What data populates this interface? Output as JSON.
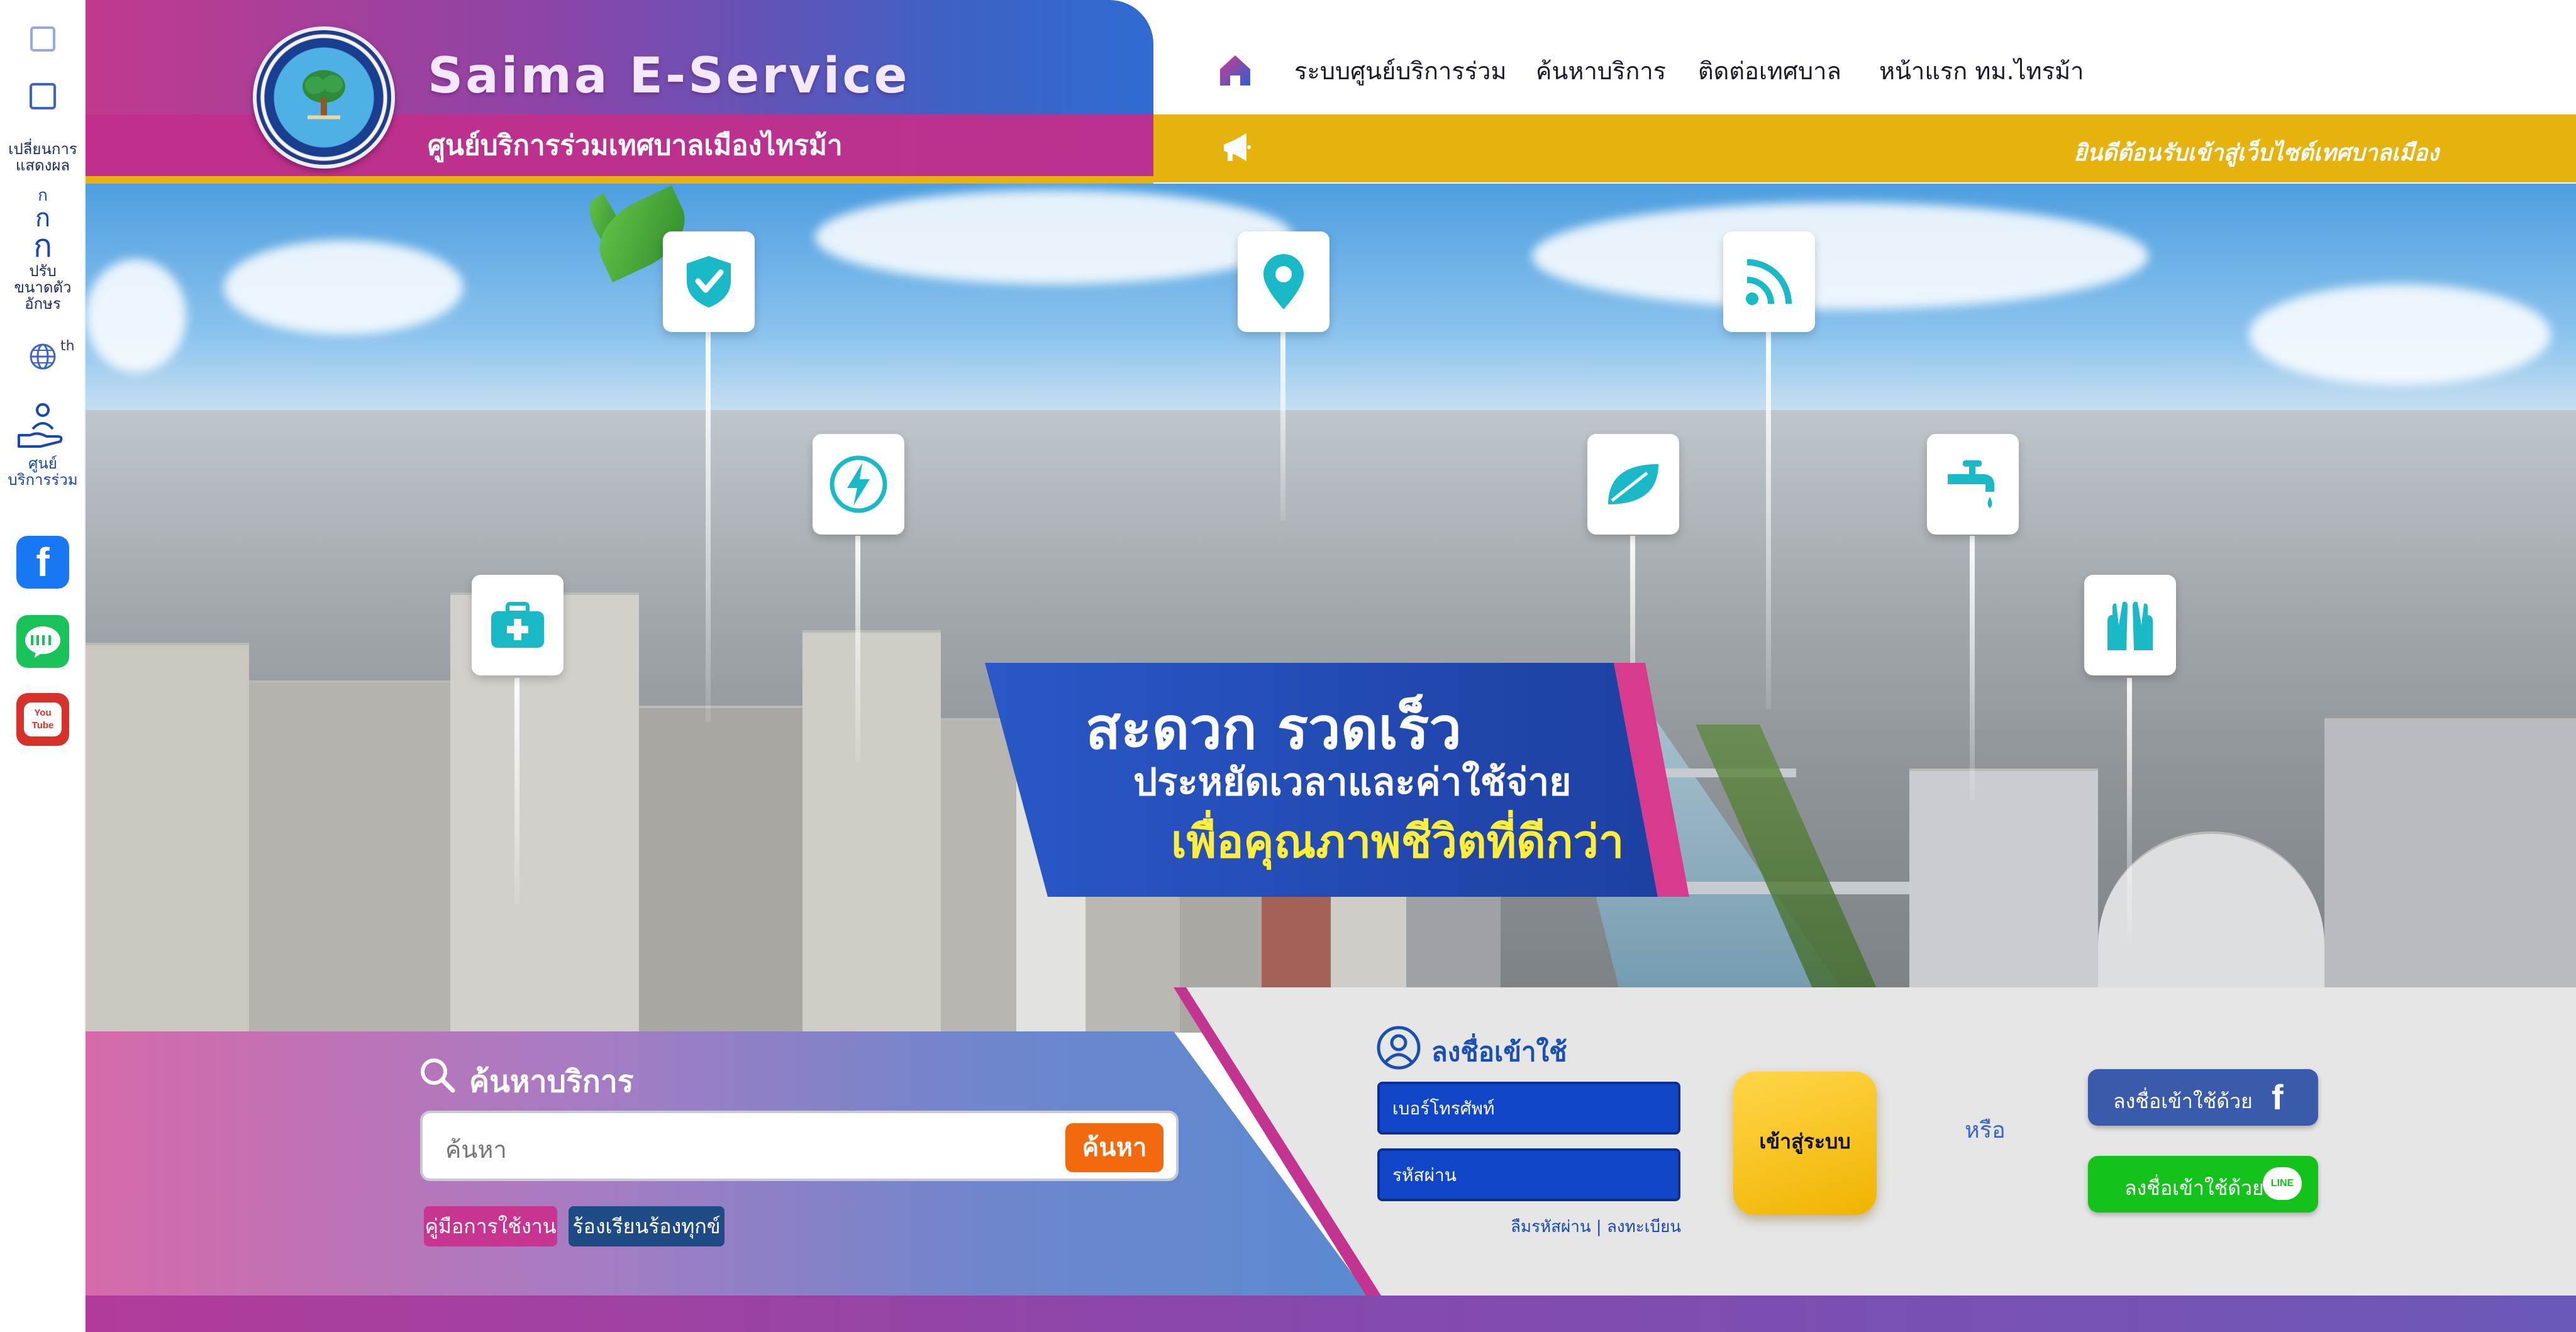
{
  "rail": {
    "display_switch_label_1": "เปลี่ยนการ",
    "display_switch_label_2": "แสดงผล",
    "font_small": "ก",
    "font_medium": "ก",
    "font_large": "ก",
    "font_label_1": "ปรับ",
    "font_label_2": "ขนาดตัว",
    "font_label_3": "อักษร",
    "language_code": "th",
    "service_center_label_1": "ศูนย์",
    "service_center_label_2": "บริการร่วม",
    "icons": [
      "grid-icon",
      "grid-icon",
      "globe-icon",
      "hand-service-icon",
      "facebook-icon",
      "line-icon",
      "youtube-icon"
    ],
    "youtube_label_1": "You",
    "youtube_label_2": "Tube"
  },
  "header": {
    "brand_title": "Saima E-Service",
    "brand_subtitle": "ศูนย์บริการร่วมเทศบาลเมืองไทรม้า",
    "nav": [
      "ระบบศูนย์บริการร่วม",
      "ค้นหาบริการ",
      "ติดต่อเทศบาล",
      "หน้าแรก ทม.ไทรม้า"
    ],
    "ticker_message": "ยินดีต้อนรับเข้าสู่เว็บไซต์เทศบาลเมือง"
  },
  "hero": {
    "line1": "สะดวก รวดเร็ว",
    "line2": "ประหยัดเวลาและค่าใช้จ่าย",
    "line3": "เพื่อคุณภาพชีวิตที่ดีกว่า",
    "pin_icons": [
      "shield-check-icon",
      "map-pin-icon",
      "wifi-icon",
      "lightning-icon",
      "leaf-icon",
      "faucet-icon",
      "medical-kit-icon",
      "hands-icon"
    ]
  },
  "search": {
    "title": "ค้นหาบริการ",
    "placeholder": "ค้นหา",
    "button": "ค้นหา",
    "manual_label": "คู่มือการใช้งาน",
    "complaint_label": "ร้องเรียนร้องทุกข์"
  },
  "login": {
    "title": "ลงชื่อเข้าใช้",
    "phone_placeholder": "เบอร์โทรศัพท์",
    "password_placeholder": "รหัสผ่าน",
    "forgot_label": "ลืมรหัสผ่าน | ลงทะเบียน",
    "submit_label": "เข้าสู่ระบบ",
    "or_label": "หรือ",
    "facebook_label": "ลงชื่อเข้าใช้ด้วย",
    "line_label": "ลงชื่อเข้าใช้ด้วย",
    "line_badge": "LINE"
  },
  "colors": {
    "brand_magenta": "#c02f8c",
    "brand_blue": "#1046c7",
    "ticker_gold": "#e6b20d",
    "search_orange": "#f26a0d",
    "line_green": "#14c21c",
    "facebook_blue": "#3a5aab"
  }
}
